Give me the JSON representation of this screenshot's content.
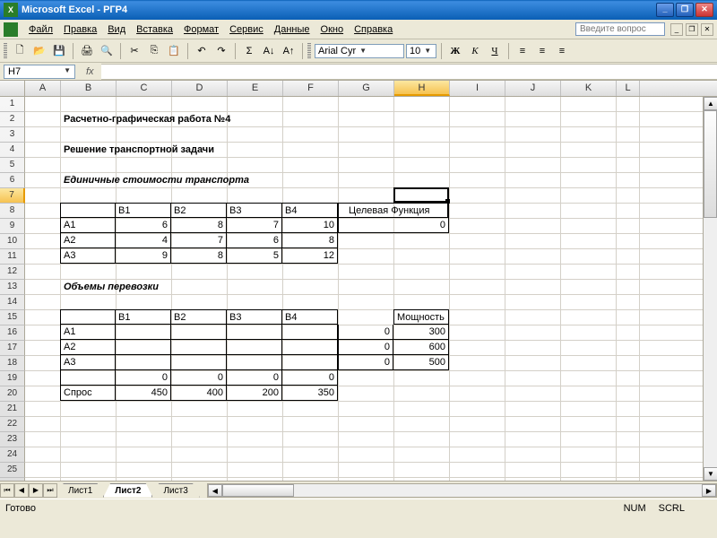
{
  "app": {
    "name": "Microsoft Excel",
    "doc": "РГР4"
  },
  "winbtns": {
    "min": "_",
    "restore": "❐",
    "close": "✕"
  },
  "menu": [
    "Файл",
    "Правка",
    "Вид",
    "Вставка",
    "Формат",
    "Сервис",
    "Данные",
    "Окно",
    "Справка"
  ],
  "help_placeholder": "Введите вопрос",
  "toolbar": {
    "font": "Arial Cyr",
    "size": "10",
    "bold": "Ж",
    "italic": "К",
    "underline": "Ч",
    "autosum": "Σ"
  },
  "namebox": "H7",
  "fx_label": "fx",
  "columns": [
    "A",
    "B",
    "C",
    "D",
    "E",
    "F",
    "G",
    "H",
    "I",
    "J",
    "K",
    "L"
  ],
  "selected_col": "H",
  "selected_row": 7,
  "content": {
    "title": "Расчетно-графическая работа №4",
    "subtitle": "Решение транспортной задачи",
    "sec1": "Единичные стоимости транспорта",
    "sec2": "Объемы перевозки",
    "obj_label": "Целевая Функция",
    "obj_value": "0",
    "cols": [
      "B1",
      "B2",
      "B3",
      "B4"
    ],
    "rows": [
      "А1",
      "А2",
      "А3"
    ],
    "costs": [
      [
        6,
        8,
        7,
        10
      ],
      [
        4,
        7,
        6,
        8
      ],
      [
        9,
        8,
        5,
        12
      ]
    ],
    "cap_label": "Мощность",
    "caps": [
      300,
      600,
      500
    ],
    "zeros": [
      0,
      0,
      0
    ],
    "colsums": [
      0,
      0,
      0,
      0
    ],
    "demand_label": "Спрос",
    "demand": [
      450,
      400,
      200,
      350
    ]
  },
  "sheets": [
    "Лист1",
    "Лист2",
    "Лист3"
  ],
  "active_sheet": 1,
  "status": {
    "ready": "Готово",
    "num": "NUM",
    "scrl": "SCRL"
  }
}
